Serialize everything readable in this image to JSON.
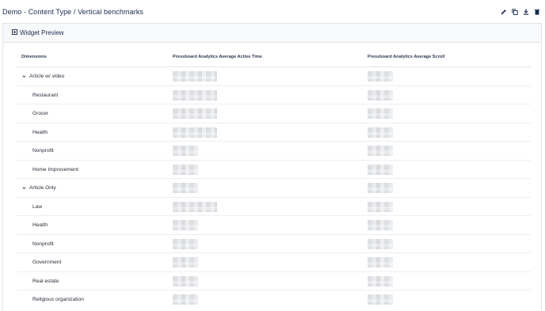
{
  "page": {
    "title": "Demo - Content Type / Vertical benchmarks"
  },
  "toolbar": {
    "icons": [
      "edit-icon",
      "copy-icon",
      "download-icon",
      "delete-icon"
    ]
  },
  "widget": {
    "title": "Widget Preview"
  },
  "table": {
    "columns": [
      "Dimensions",
      "Pressboard Analytics Average Active Time",
      "Pressboard Analytics Average Scroll"
    ],
    "rows": [
      {
        "label": "Article w/ video",
        "type": "group",
        "time_blur": "wide",
        "scroll_blur": "narrow"
      },
      {
        "label": "Restaurant",
        "type": "child",
        "time_blur": "wide",
        "scroll_blur": "narrow"
      },
      {
        "label": "Grocer",
        "type": "child",
        "time_blur": "wide",
        "scroll_blur": "narrow"
      },
      {
        "label": "Health",
        "type": "child",
        "time_blur": "wide",
        "scroll_blur": "narrow"
      },
      {
        "label": "Nonprofit",
        "type": "child",
        "time_blur": "narrow",
        "scroll_blur": "narrow"
      },
      {
        "label": "Home Improvement",
        "type": "child",
        "time_blur": "narrow",
        "scroll_blur": "narrow"
      },
      {
        "label": "Article Only",
        "type": "group",
        "time_blur": "narrow",
        "scroll_blur": "narrow"
      },
      {
        "label": "Law",
        "type": "child",
        "time_blur": "wide",
        "scroll_blur": "narrow"
      },
      {
        "label": "Health",
        "type": "child",
        "time_blur": "narrow",
        "scroll_blur": "narrow"
      },
      {
        "label": "Nonprofit",
        "type": "child",
        "time_blur": "narrow",
        "scroll_blur": "narrow"
      },
      {
        "label": "Government",
        "type": "child",
        "time_blur": "narrow",
        "scroll_blur": "narrow"
      },
      {
        "label": "Real estate",
        "type": "child",
        "time_blur": "narrow",
        "scroll_blur": "narrow"
      },
      {
        "label": "Religious organization",
        "type": "child",
        "time_blur": "narrow",
        "scroll_blur": "narrow"
      }
    ]
  },
  "colors": {
    "title": "#1b2a4e",
    "header_bg": "#f8f9fa",
    "border": "#e2e5ea"
  }
}
